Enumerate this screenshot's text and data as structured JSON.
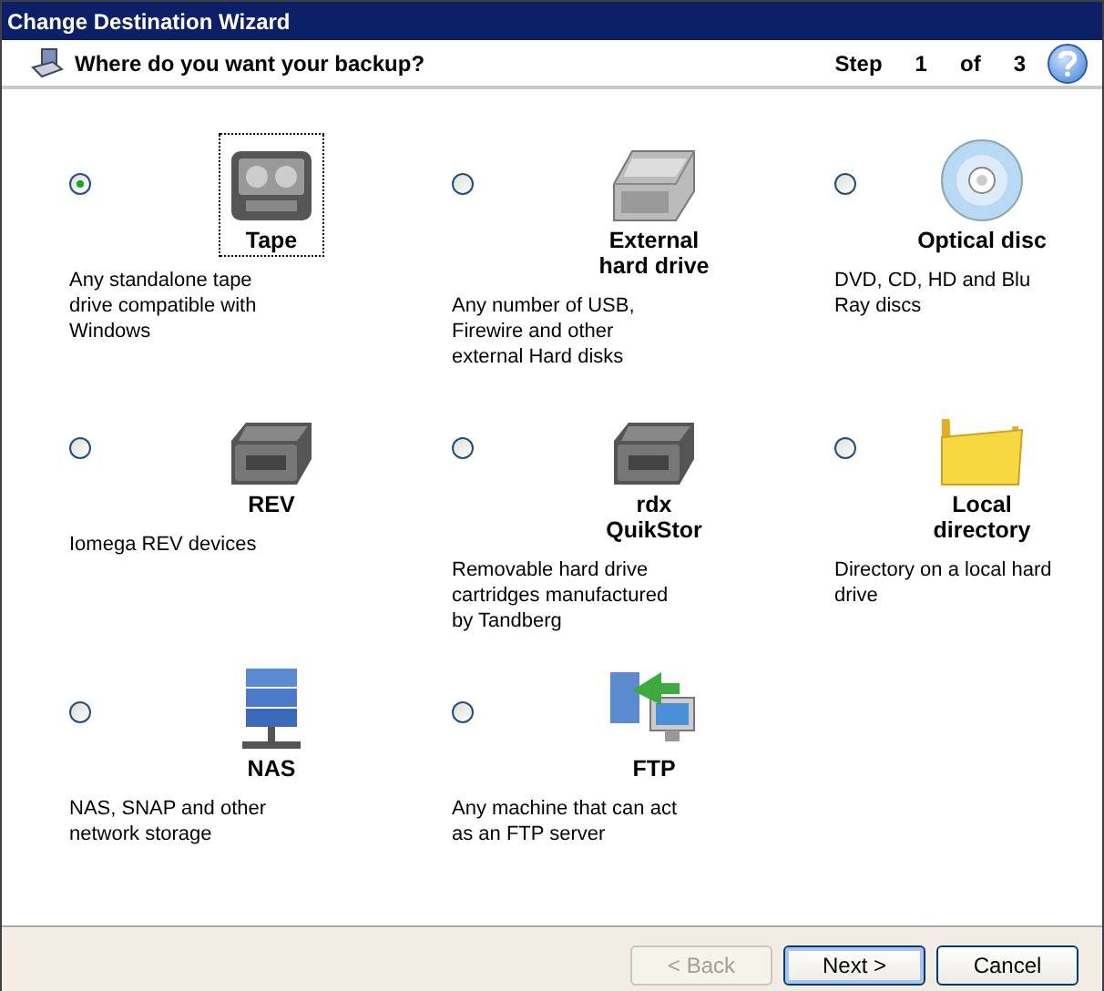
{
  "window": {
    "title": "Change Destination Wizard"
  },
  "header": {
    "question": "Where do you want your backup?",
    "step_word": "Step",
    "step": "1",
    "of_word": "of",
    "total": "3"
  },
  "options": [
    {
      "kind": "tape",
      "label_lines": [
        "Tape"
      ],
      "description": "Any standalone tape drive compatible with Windows",
      "selected": true,
      "focused": true
    },
    {
      "kind": "hdd",
      "label_lines": [
        "External",
        "hard drive"
      ],
      "description": "Any number of USB, Firewire and other external Hard disks",
      "selected": false,
      "focused": false
    },
    {
      "kind": "disc",
      "label_lines": [
        "Optical disc"
      ],
      "description": "DVD, CD, HD and Blu Ray discs",
      "selected": false,
      "focused": false
    },
    {
      "kind": "drive",
      "label_lines": [
        "REV"
      ],
      "description": "Iomega REV devices",
      "selected": false,
      "focused": false
    },
    {
      "kind": "drive",
      "label_lines": [
        "rdx",
        "QuikStor"
      ],
      "description": "Removable hard drive cartridges manufactured by Tandberg",
      "selected": false,
      "focused": false
    },
    {
      "kind": "folder",
      "label_lines": [
        "Local",
        "directory"
      ],
      "description": "Directory on a local hard drive",
      "selected": false,
      "focused": false
    },
    {
      "kind": "nas",
      "label_lines": [
        "NAS"
      ],
      "description": "NAS, SNAP and other network storage",
      "selected": false,
      "focused": false
    },
    {
      "kind": "ftp",
      "label_lines": [
        "FTP"
      ],
      "description": "Any machine that can act as an FTP server",
      "selected": false,
      "focused": false
    }
  ],
  "buttons": [
    {
      "label": "< Back",
      "disabled": true,
      "default": false
    },
    {
      "label": "Next >",
      "disabled": false,
      "default": true
    },
    {
      "label": "Cancel",
      "disabled": false,
      "default": false
    }
  ]
}
